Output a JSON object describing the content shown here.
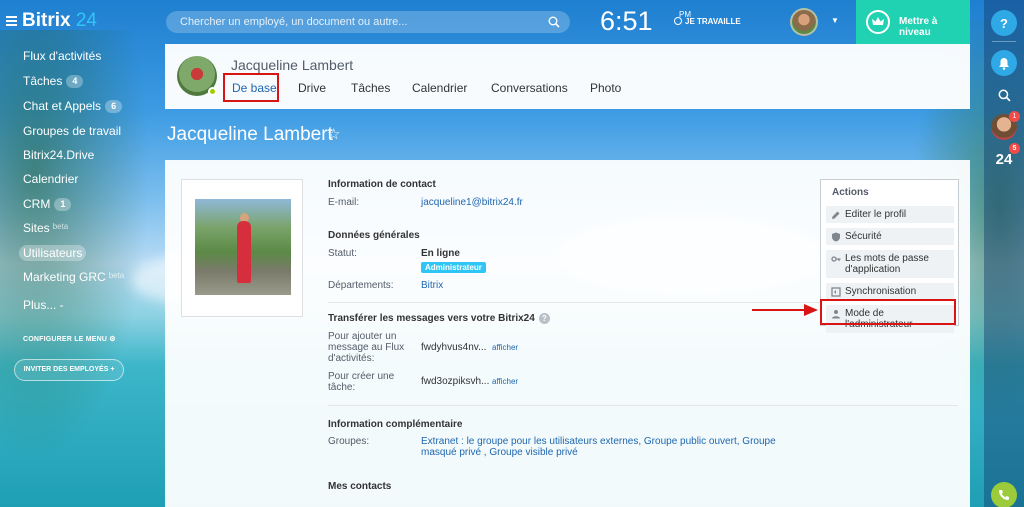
{
  "app": {
    "logo_text": "Bitrix",
    "logo_num": "24"
  },
  "search": {
    "placeholder": "Chercher un employé, un document ou autre..."
  },
  "clock": {
    "time": "6:51",
    "ampm": "PM",
    "work_status": "JE TRAVAILLE"
  },
  "upgrade": {
    "label": "Mettre à niveau"
  },
  "menu": {
    "items": [
      {
        "label": "Flux d'activités"
      },
      {
        "label": "Tâches",
        "count": "4"
      },
      {
        "label": "Chat et Appels",
        "count": "6"
      },
      {
        "label": "Groupes de travail"
      },
      {
        "label": "Bitrix24.Drive"
      },
      {
        "label": "Calendrier"
      },
      {
        "label": "CRM",
        "count": "1"
      },
      {
        "label": "Sites",
        "beta": "beta"
      },
      {
        "label": "Utilisateurs"
      },
      {
        "label": "Marketing GRC",
        "beta": "beta"
      },
      {
        "label": "Plus... -"
      }
    ],
    "configure": "CONFIGURER LE MENU",
    "invite": "INVITER DES EMPLOYÉS"
  },
  "profile": {
    "name": "Jacqueline Lambert",
    "tabs": [
      "De base",
      "Drive",
      "Tâches",
      "Calendrier",
      "Conversations",
      "Photo"
    ],
    "page_title": "Jacqueline Lambert"
  },
  "contact": {
    "title": "Information de contact",
    "email_label": "E-mail:",
    "email": "jacqueline1@bitrix24.fr"
  },
  "general": {
    "title": "Données générales",
    "status_label": "Statut:",
    "status": "En ligne",
    "role_badge": "Administrateur",
    "dept_label": "Départements:",
    "dept": "Bitrix"
  },
  "transfer": {
    "title": "Transférer les messages vers votre Bitrix24",
    "help": "?",
    "feed_label": "Pour ajouter un message au Flux d'activités:",
    "feed_code": "fwdyhvus4nv...",
    "task_label": "Pour créer une tâche:",
    "task_code": "fwd3ozpiksvh...",
    "show": "afficher"
  },
  "extra": {
    "title": "Information complémentaire",
    "groups_label": "Groupes:",
    "groups": "Extranet : le groupe pour les utilisateurs externes, Groupe public ouvert, Groupe masqué privé , Groupe visible privé"
  },
  "contacts_title": "Mes contacts",
  "actions": {
    "title": "Actions",
    "items": [
      "Editer le profil",
      "Sécurité",
      "Les mots de passe d'application",
      "Synchronisation",
      "Mode de l'administrateur"
    ]
  },
  "rail": {
    "help": "?",
    "avatar_badge": "1",
    "b24": "24",
    "b24_badge": "5"
  },
  "colors": {
    "accent": "#2067b0",
    "upgrade": "#21d2b2",
    "highlight": "#d81414",
    "admin_badge": "#2fc6f6"
  }
}
